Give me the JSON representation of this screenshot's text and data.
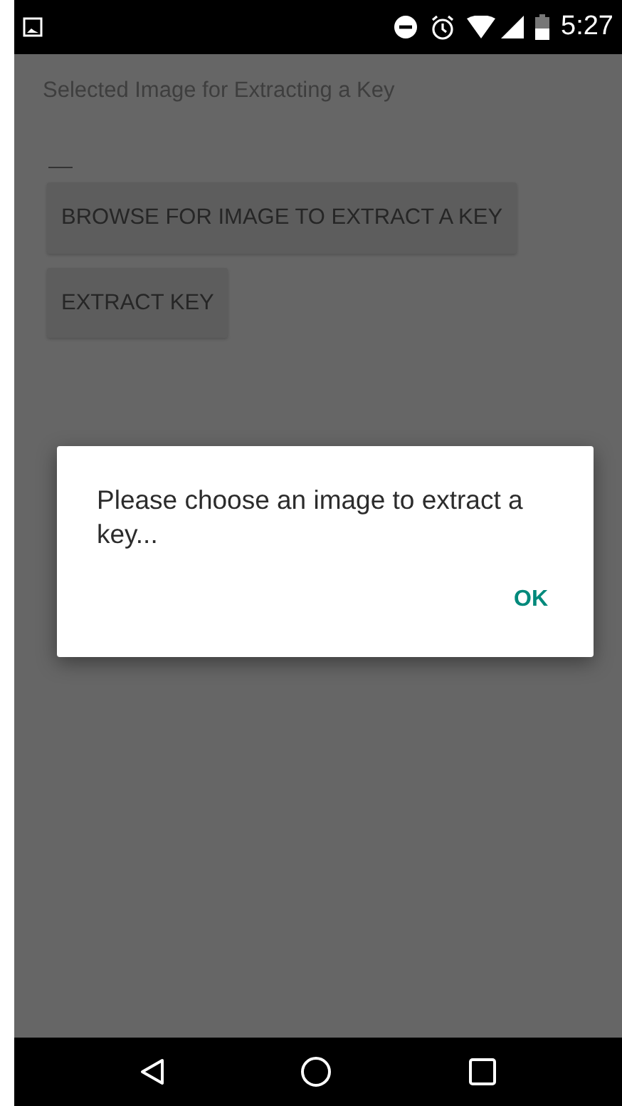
{
  "status_bar": {
    "time": "5:27"
  },
  "screen": {
    "title": "Selected Image for Extracting a Key",
    "buttons": [
      "BROWSE FOR IMAGE TO EXTRACT A KEY",
      "EXTRACT KEY"
    ]
  },
  "dialog": {
    "message": "Please choose an image to extract a key...",
    "buttons": [
      "OK"
    ]
  }
}
